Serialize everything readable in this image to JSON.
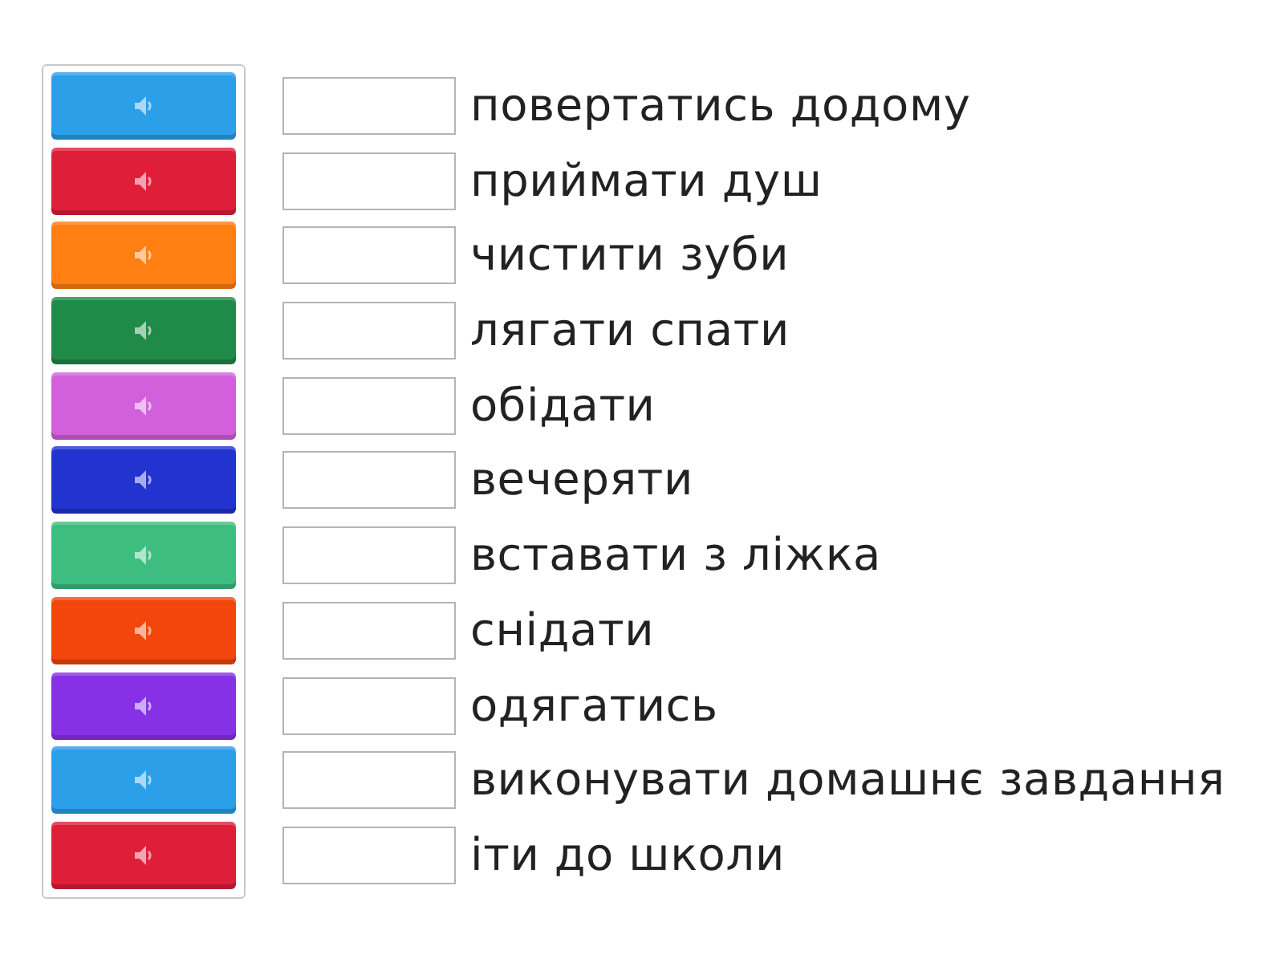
{
  "audio_buttons": [
    {
      "color": "#2b9fe8"
    },
    {
      "color": "#df1f3a"
    },
    {
      "color": "#ff7f12"
    },
    {
      "color": "#208a48"
    },
    {
      "color": "#d260dc"
    },
    {
      "color": "#2333cf"
    },
    {
      "color": "#3dbe80"
    },
    {
      "color": "#f2460c"
    },
    {
      "color": "#8631e6"
    },
    {
      "color": "#2b9fe8"
    },
    {
      "color": "#df1f3a"
    }
  ],
  "rows": [
    {
      "text": "повертатись додому"
    },
    {
      "text": "приймати душ"
    },
    {
      "text": "чистити зуби"
    },
    {
      "text": "лягати спати"
    },
    {
      "text": "обідати"
    },
    {
      "text": "вечеряти"
    },
    {
      "text": "вставати з ліжка"
    },
    {
      "text": "снідати"
    },
    {
      "text": "одягатись"
    },
    {
      "text": "виконувати домашнє завдання"
    },
    {
      "text": "іти до школи"
    }
  ]
}
